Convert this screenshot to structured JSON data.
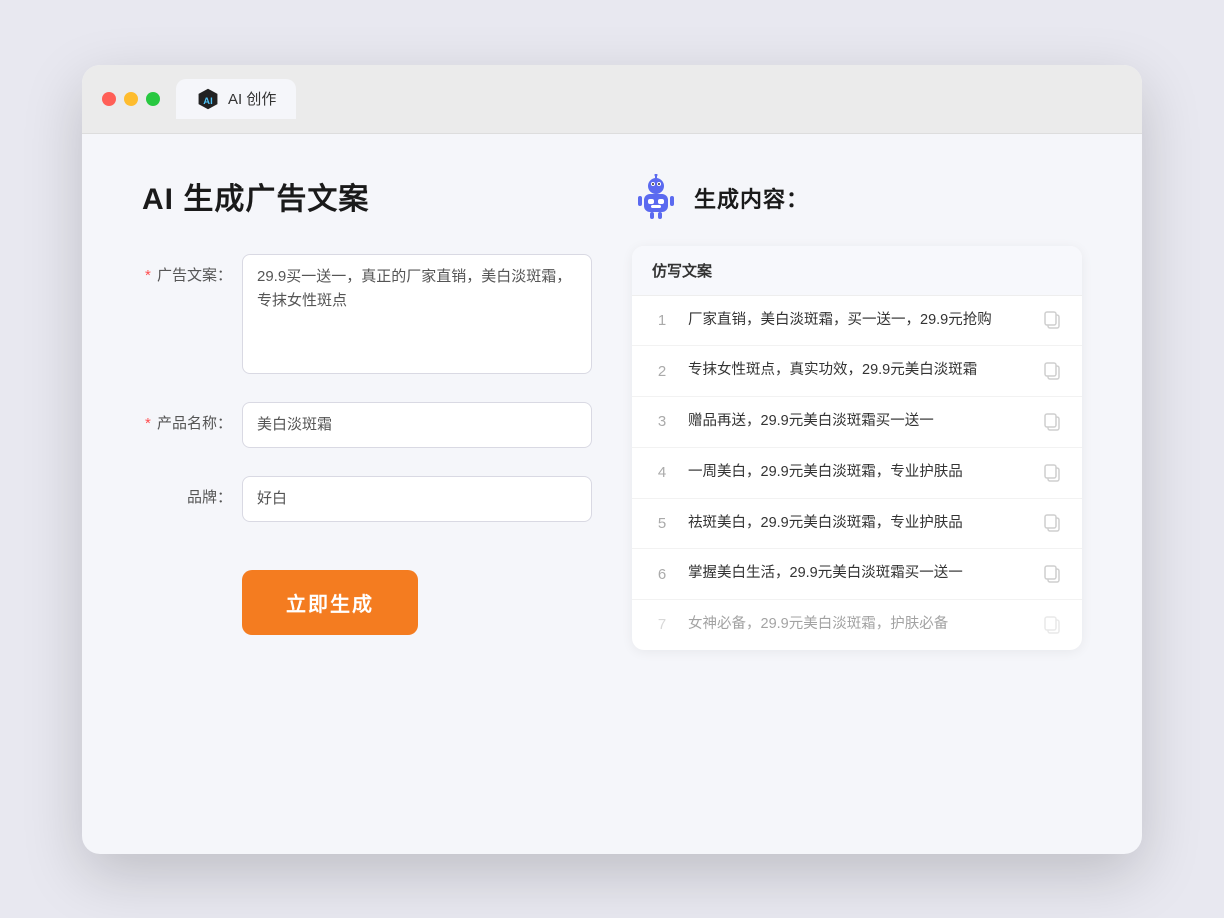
{
  "window": {
    "tab_label": "AI 创作"
  },
  "left": {
    "title": "AI 生成广告文案",
    "fields": [
      {
        "id": "ad-copy",
        "label": "广告文案：",
        "required": true,
        "type": "textarea",
        "value": "29.9买一送一，真正的厂家直销，美白淡斑霜，专抹女性斑点"
      },
      {
        "id": "product-name",
        "label": "产品名称：",
        "required": true,
        "type": "input",
        "value": "美白淡斑霜"
      },
      {
        "id": "brand",
        "label": "品牌：",
        "required": false,
        "type": "input",
        "value": "好白"
      }
    ],
    "button_label": "立即生成"
  },
  "right": {
    "title": "生成内容：",
    "table_header": "仿写文案",
    "results": [
      {
        "number": "1",
        "text": "厂家直销，美白淡斑霜，买一送一，29.9元抢购",
        "dimmed": false
      },
      {
        "number": "2",
        "text": "专抹女性斑点，真实功效，29.9元美白淡斑霜",
        "dimmed": false
      },
      {
        "number": "3",
        "text": "赠品再送，29.9元美白淡斑霜买一送一",
        "dimmed": false
      },
      {
        "number": "4",
        "text": "一周美白，29.9元美白淡斑霜，专业护肤品",
        "dimmed": false
      },
      {
        "number": "5",
        "text": "祛斑美白，29.9元美白淡斑霜，专业护肤品",
        "dimmed": false
      },
      {
        "number": "6",
        "text": "掌握美白生活，29.9元美白淡斑霜买一送一",
        "dimmed": false
      },
      {
        "number": "7",
        "text": "女神必备，29.9元美白淡斑霜，护肤必备",
        "dimmed": true
      }
    ]
  }
}
